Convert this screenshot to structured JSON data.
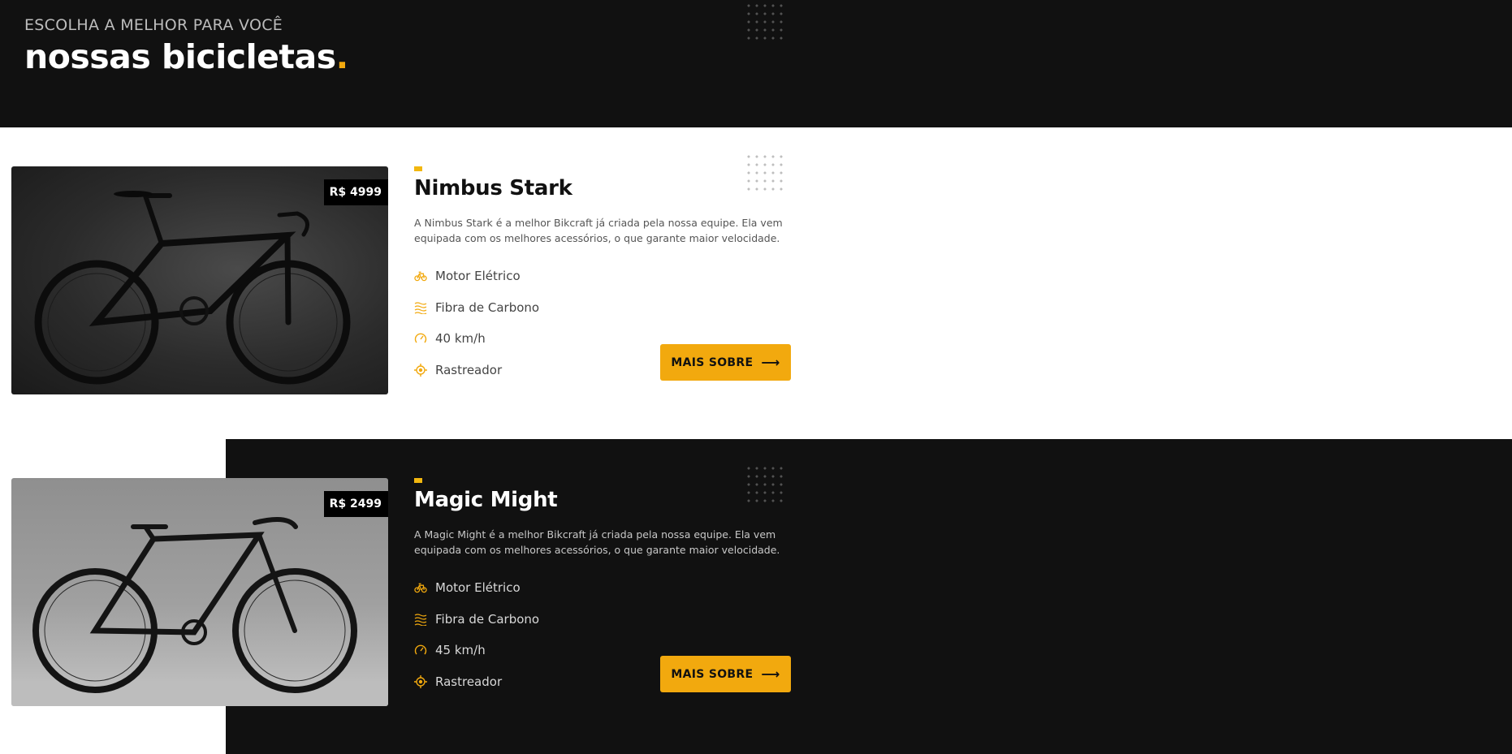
{
  "header": {
    "eyebrow": "ESCOLHA A MELHOR PARA VOCÊ",
    "title": "nossas bicicletas",
    "title_dot": "."
  },
  "colors": {
    "accent": "#f2a90e",
    "dark_bg": "#111111",
    "light_bg": "#ffffff"
  },
  "products": [
    {
      "name": "Nimbus Stark",
      "price": "R$ 4999",
      "description": "A Nimbus Stark é a melhor Bikcraft já criada pela nossa equipe. Ela vem equipada com os melhores acessórios, o que garante maior velocidade.",
      "features": [
        {
          "icon": "electric-bike-icon",
          "label": "Motor Elétrico"
        },
        {
          "icon": "carbon-waves-icon",
          "label": "Fibra de Carbono"
        },
        {
          "icon": "speedometer-icon",
          "label": "40 km/h"
        },
        {
          "icon": "tracker-icon",
          "label": "Rastreador"
        }
      ],
      "button": "MAIS SOBRE",
      "image": "black road bike on dark background"
    },
    {
      "name": "Magic Might",
      "price": "R$ 2499",
      "description": "A Magic Might é a melhor Bikcraft já criada pela nossa equipe. Ela vem equipada com os melhores acessórios, o que garante maior velocidade.",
      "features": [
        {
          "icon": "electric-bike-icon",
          "label": "Motor Elétrico"
        },
        {
          "icon": "carbon-waves-icon",
          "label": "Fibra de Carbono"
        },
        {
          "icon": "speedometer-icon",
          "label": "45 km/h"
        },
        {
          "icon": "tracker-icon",
          "label": "Rastreador"
        }
      ],
      "button": "MAIS SOBRE",
      "image": "black fixed-gear bike against concrete wall"
    }
  ]
}
